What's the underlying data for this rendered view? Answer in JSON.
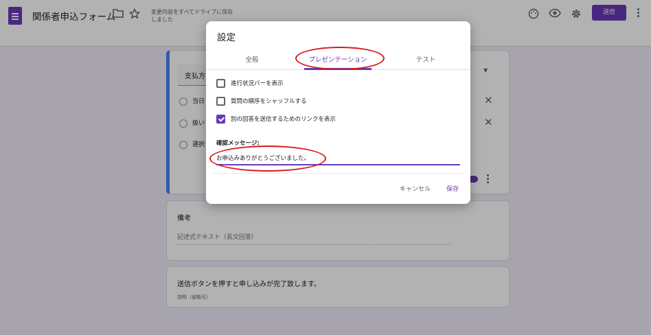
{
  "header": {
    "doc_title": "関係者申込フォーム",
    "save_status": "変更内容をすべてドライブに保存しました",
    "send_label": "送信",
    "icons": [
      "forms-app-icon",
      "folder-icon",
      "star-icon",
      "palette-icon",
      "preview-eye-icon",
      "settings-gear-icon",
      "more-vert-icon"
    ]
  },
  "question_card": {
    "title_partial": "支払方",
    "options": [
      "当日",
      "扱い",
      "選択"
    ]
  },
  "remarks_card": {
    "title": "備考",
    "hint": "記述式テキスト（長文回答）"
  },
  "description_card": {
    "title": "送信ボタンを押すと申し込みが完了致します。",
    "subtitle": "説明（省略可）"
  },
  "dialog": {
    "title": "設定",
    "tabs": [
      "全般",
      "プレゼンテーション",
      "テスト"
    ],
    "active_tab": "プレゼンテーション",
    "checkboxes": [
      {
        "label": "進行状況バーを表示",
        "checked": false
      },
      {
        "label": "質問の順序をシャッフルする",
        "checked": false
      },
      {
        "label": "別の回答を送信するためのリンクを表示",
        "checked": true
      }
    ],
    "confirm_label": "確認メッセージ:",
    "confirm_value": "お申込みありがとうございました。",
    "cancel_label": "キャンセル",
    "save_label": "保存"
  },
  "colors": {
    "accent": "#673ab7",
    "annotation": "#d8171f",
    "background": "#f0ebf8"
  }
}
